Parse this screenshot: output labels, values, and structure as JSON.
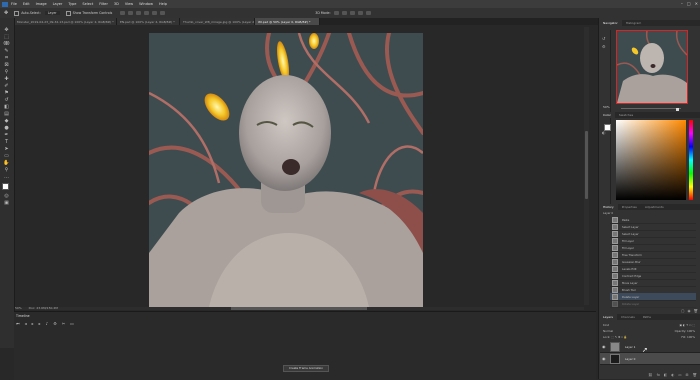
{
  "menu": {
    "items": [
      "File",
      "Edit",
      "Image",
      "Layer",
      "Type",
      "Select",
      "Filter",
      "3D",
      "View",
      "Window",
      "Help"
    ]
  },
  "options": {
    "auto_select_label": "Auto-Select:",
    "layer_select": "Layer",
    "transform_label": "Show Transform Controls",
    "mode_label": "3D Mode:"
  },
  "tabs": [
    {
      "label": "Monster_2019-04-23_09-32-13.psd @ 100% (Layer 2, RGB/8#) *"
    },
    {
      "label": "EN.psd @ 100% (Layer 4, RGB/8#) *"
    },
    {
      "label": "Thumb_cover_W8_mirage.jpg @ 100% (Layer 2, RGB/8#) *"
    },
    {
      "label": "WI.psd @ 50% (Layer 0, RGB/8#) *"
    }
  ],
  "status": {
    "zoom": "50%",
    "doc": "Doc: 23.6M/150.2M"
  },
  "timeline": {
    "title": "Timeline",
    "create_button": "Create Frame Animation"
  },
  "panels": {
    "navigator": {
      "tabs": [
        "Navigator",
        "Histogram"
      ],
      "zoom": "50%"
    },
    "color": {
      "tabs": [
        "Color",
        "Swatches"
      ]
    },
    "history": {
      "tabs": [
        "History",
        "Properties",
        "Adjustments"
      ],
      "file": "Layer 0",
      "items": [
        "Paste",
        "Select Layer",
        "Select Layer",
        "Fill Layer",
        "Fill Layer",
        "Free Transform",
        "Gaussian Blur",
        "Levels Edit",
        "Contract Edge",
        "Move Layer",
        "Brush Tool",
        "Delete Layer",
        "Rotate Layer"
      ],
      "active": "Delete Layer"
    },
    "layers": {
      "tabs": [
        "Layers",
        "Channels",
        "Paths"
      ],
      "kind_label": "Kind",
      "blend_mode": "Normal",
      "opacity_label": "Opacity:",
      "opacity": "100%",
      "lock_label": "Lock:",
      "fill_label": "Fill:",
      "fill": "100%",
      "items": [
        {
          "name": "Layer 1"
        },
        {
          "name": "Layer 0"
        }
      ]
    }
  },
  "colors": {
    "accent": "#4a4a4a",
    "nav_border": "#dd2222",
    "history_active": "#3d4a5c"
  }
}
